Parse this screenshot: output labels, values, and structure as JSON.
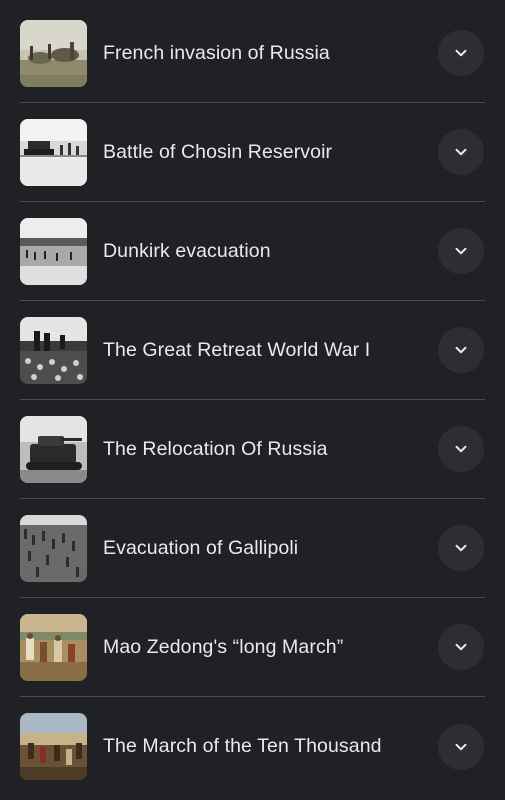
{
  "items": [
    {
      "label": "French invasion of Russia",
      "thumb_icon": "painting-thumbnail"
    },
    {
      "label": "Battle of Chosin Reservoir",
      "thumb_icon": "photo-thumbnail"
    },
    {
      "label": "Dunkirk evacuation",
      "thumb_icon": "photo-thumbnail"
    },
    {
      "label": "The Great Retreat World War I",
      "thumb_icon": "photo-thumbnail"
    },
    {
      "label": "The Relocation Of Russia",
      "thumb_icon": "photo-thumbnail"
    },
    {
      "label": "Evacuation of Gallipoli",
      "thumb_icon": "photo-thumbnail"
    },
    {
      "label": "Mao Zedong's “long March”",
      "thumb_icon": "painting-thumbnail"
    },
    {
      "label": "The March of the Ten Thousand",
      "thumb_icon": "painting-thumbnail"
    }
  ],
  "colors": {
    "background": "#202124",
    "text": "#e8eaed",
    "divider": "#4a4b4e",
    "button_bg": "#2d2e31"
  },
  "expand_icon": "chevron-down-icon"
}
